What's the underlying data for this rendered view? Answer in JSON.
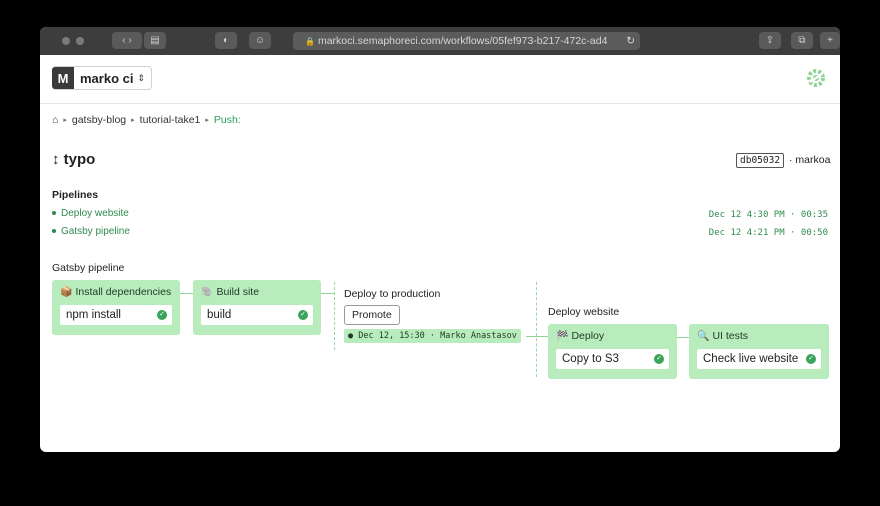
{
  "browser": {
    "url": "markoci.semaphoreci.com/workflows/05fef973-b217-472c-ad4",
    "sidebar_icon": "sidebar-icon",
    "share_icon": "share-icon",
    "tabs_icon": "tabs-icon"
  },
  "org": {
    "initial": "M",
    "name": "marko ci",
    "caret": "⇕"
  },
  "breadcrumb": {
    "home_icon": "home-icon",
    "sep": "▸",
    "project": "gatsby-blog",
    "branch": "tutorial-take1",
    "current": "Push:"
  },
  "workflow": {
    "arrow": "↕",
    "title": "typo",
    "commit": "db05032",
    "author": "· markoa"
  },
  "pipelines": {
    "heading": "Pipelines",
    "items": [
      {
        "name": "Deploy website",
        "meta": "Dec 12 4:30 PM · 00:35"
      },
      {
        "name": "Gatsby pipeline",
        "meta": "Dec 12 4:21 PM · 00:50"
      }
    ]
  },
  "graph": {
    "title": "Gatsby pipeline",
    "blocks": [
      {
        "name": "Install dependencies",
        "icon": "📦",
        "job": "npm install"
      },
      {
        "name": "Build site",
        "icon": "🐘",
        "job": "build"
      }
    ],
    "promotion": {
      "title": "Deploy to production",
      "button": "Promote",
      "info": "Dec 12, 15:30 · Marko Anastasov"
    },
    "deploy_pipeline": {
      "title": "Deploy website",
      "blocks": [
        {
          "name": "Deploy",
          "icon": "🏁",
          "job": "Copy to S3"
        },
        {
          "name": "UI tests",
          "icon": "🔍",
          "job": "Check live website"
        }
      ]
    }
  },
  "colors": {
    "accent": "#31a05a",
    "block_bg": "#b9ecbd",
    "chrome": "#3d3d3d"
  }
}
